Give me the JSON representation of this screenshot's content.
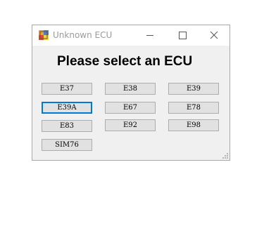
{
  "window": {
    "title": "Unknown ECU",
    "heading": "Please select an ECU"
  },
  "title_controls": {
    "minimize_icon": "minimize-icon",
    "maximize_icon": "maximize-icon",
    "close_icon": "close-icon"
  },
  "ecu_buttons": [
    {
      "label": "E37",
      "focused": false
    },
    {
      "label": "E38",
      "focused": false
    },
    {
      "label": "E39",
      "focused": false
    },
    {
      "label": "E39A",
      "focused": true
    },
    {
      "label": "E67",
      "focused": false
    },
    {
      "label": "E78",
      "focused": false
    },
    {
      "label": "E83",
      "focused": false
    },
    {
      "label": "E92",
      "focused": false
    },
    {
      "label": "E98",
      "focused": false
    },
    {
      "label": "SIM76",
      "focused": false
    }
  ],
  "colors": {
    "focus_border": "#0078d7",
    "button_face": "#e1e1e1",
    "window_background": "#f0f0f0"
  }
}
